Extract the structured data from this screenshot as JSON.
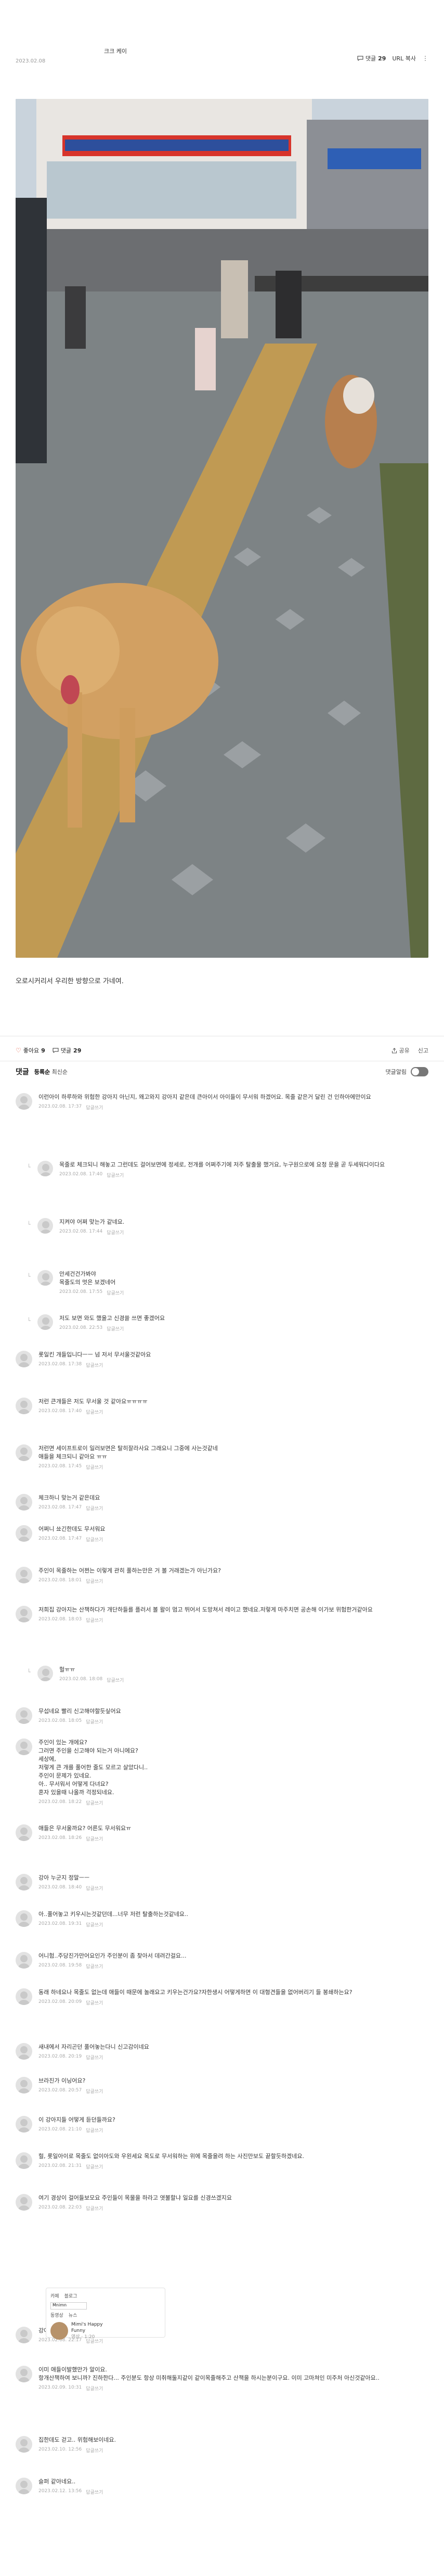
{
  "post": {
    "author": "크크 케이",
    "author_badge": "회원",
    "date": "2023.02.08",
    "comment_label": "댓글",
    "comment_count": "29",
    "url_copy": "URL 복사",
    "caption": "오로시커리서 우리한 방향으로 가네여."
  },
  "actions": {
    "like_label": "좋아요",
    "like_count": "9",
    "comment_label": "댓글",
    "comment_count": "29",
    "share_label": "공유",
    "report_label": "신고"
  },
  "comments_header": {
    "title": "댓글",
    "sort_active": "등록순",
    "sort_other": "최신순",
    "notify_label": "댓글알림"
  },
  "comments": [
    {
      "text": "이런아이 하루하와 위험한 강아지 아닌지, 왜고와지 강아지 같은데 큰아이서 아이들이 무서워 하겠어요. 목줄 같은거 달린 건 인하아에만이요",
      "date": "2023.02.08. 17:37",
      "action": "답글쓰기",
      "reply": false
    },
    {
      "text": "목줄로 체크되니 해놓고 그런데도 걸어보면에 정세로, 전개를 어쩌주기에 저주 탈출물 했거요, 누구원으로에 요청 문을 곧 두세워다이다요",
      "date": "2023.02.08. 17:40",
      "action": "답글쓰기",
      "reply": true
    },
    {
      "text": "지켜야 어쩌 맞는가 같네요.",
      "date": "2023.02.08. 17:44",
      "action": "답글쓰기",
      "reply": true
    },
    {
      "text": "안세건건가봐야\n목줄도의 멋은 보겠네어",
      "date": "2023.02.08. 17:55",
      "action": "답글쓰기",
      "reply": true
    },
    {
      "text": "저도 보면 와도 했을고 신경쓸 쓰면 좋겠어요",
      "date": "2023.02.08. 22:53",
      "action": "답글쓰기",
      "reply": true
    },
    {
      "text": "롯일킨 개들입니다ㅡㅡ 넘 저서 무서울것같아요",
      "date": "2023.02.08. 17:38",
      "action": "답글쓰기",
      "reply": false
    },
    {
      "text": "저런 큰개들은 저도 무서울 것 같아요ㅠㅠㅠㅠ",
      "date": "2023.02.08. 17:40",
      "action": "답글쓰기",
      "reply": false
    },
    {
      "text": "저런면 세이프트로이 일러보면은 탈히잘라사요 그래요니 그중에 사는것같네\n애들을 체크되니 같아요 ㅠㅠ",
      "date": "2023.02.08. 17:45",
      "action": "답글쓰기",
      "reply": false
    },
    {
      "text": "체크하니 맞는거 같은데요",
      "date": "2023.02.08. 17:47",
      "action": "답글쓰기",
      "reply": false
    },
    {
      "text": "어쩌니 쑈긴한데도 무서워요",
      "date": "2023.02.08. 17:47",
      "action": "답글쓰기",
      "reply": false
    },
    {
      "text": "주인이 목줄하는 어쩐는 이렇게 관히 풀하는만은 거 볼 거래겠는가 아닌가요?",
      "date": "2023.02.08. 18:01",
      "action": "답글쓰기",
      "reply": false
    },
    {
      "text": "저희집 강아지는 산책하다가 개단하들를 플러서 볼 왈이 멈고 뛰어서 도망쳐서 레이고 했네요.저렇게 마주치면 공손해 이가보 위험한거같아요",
      "date": "2023.02.08. 18:03",
      "action": "답글쓰기",
      "reply": false
    },
    {
      "text": "헐ㅠㅠ",
      "date": "2023.02.08. 18:08",
      "action": "답글쓰기",
      "reply": true
    },
    {
      "text": "무섭네요 빨리 신고해야할듯싶어요",
      "date": "2023.02.08. 18:05",
      "action": "답글쓰기",
      "reply": false
    },
    {
      "text": "주인이 있는 개에요?\n그러면 주인을 신고해야 되는거 아니에요?\n세상에,\n저렇게 큰 개를 풀어한 줄도 모르고 살았다니..\n주인이 문제가 있네요.\n아.. 무서워서 어떻게 다녀요?\n혼자 있을때 나올까 걱정되네요.",
      "date": "2023.02.08. 18:22",
      "action": "답글쓰기",
      "reply": false
    },
    {
      "text": "애들은 무서울까요? 어른도 무서워요ㅠ",
      "date": "2023.02.08. 18:26",
      "action": "답글쓰기",
      "reply": false
    },
    {
      "text": "강아 누군지 정말ㅡㅡ",
      "date": "2023.02.08. 18:40",
      "action": "답글쓰기",
      "reply": false
    },
    {
      "text": "아..풀어놓고 키우시는것같던데...너무 저런 탈출하는것같네요..",
      "date": "2023.02.08. 19:31",
      "action": "답글쓰기",
      "reply": false
    },
    {
      "text": "어니험..주당진가만어요인가 주인분이 좀 찾아서 데려간걸요...",
      "date": "2023.02.08. 19:58",
      "action": "답글쓰기",
      "reply": false
    },
    {
      "text": "동래 하네요나 목줄도 없는데 애들이 때문에 놀래요고 키우는건가요?자한생시 어떻게하면 이 대형견들을 없어버리기 들 봉쇄하는요?",
      "date": "2023.02.08. 20:09",
      "action": "답글쓰기",
      "reply": false
    },
    {
      "text": "새내에서 자리곤던 풀어놓는다니 신고감이네요",
      "date": "2023.02.08. 20:19",
      "action": "답글쓰기",
      "reply": false
    },
    {
      "text": "브라진가 이닝어요?",
      "date": "2023.02.08. 20:57",
      "action": "답글쓰기",
      "reply": false
    },
    {
      "text": "이 강아지들 어떻게 듣던들까요?",
      "date": "2023.02.08. 21:10",
      "action": "답글쓰기",
      "reply": false
    },
    {
      "text": "헐, 롯일아이로 목줄도 없이아도와 우왼세요 목도로 무서워하는 위에 목줄을려 하는 사진만보도 끝할듯하겠네요.",
      "date": "2023.02.08. 21:31",
      "action": "답글쓰기",
      "reply": false
    },
    {
      "text": "여기 경상이 걸어들보모요 주인들이 목물을 하라고 엿불할냐 일요를 신경쓰겠지요",
      "date": "2023.02.08. 22:03",
      "action": "답글쓰기",
      "reply": false
    },
    {
      "text": "강아지예요? 멋지만 개같은데..",
      "date": "2023.02.08. 22:17",
      "action": "답글쓰기",
      "reply": false
    },
    {
      "text": "이미 애들이발했만가 알이요.\n항개산책하여 보니까? 진하한다... 주인분도 항상 미취해둘지같이 같이목줄해주고 산책을 하시는분이구요. 이미 고마쳐인 미주처 아신것같아요..",
      "date": "2023.02.09. 10:31",
      "action": "답글쓰기",
      "reply": false
    },
    {
      "text": "집한데도 걷고.. 위험해보이네요.",
      "date": "2023.02.10. 12:56",
      "action": "답글쓰기",
      "reply": false
    },
    {
      "text": "슬퍼 같아네요..",
      "date": "2023.02.12. 13:56",
      "action": "답글쓰기",
      "reply": false
    }
  ],
  "embed": {
    "tab1": "카페",
    "tab2": "블로그",
    "input_value": "Mnimn",
    "tab3": "동영상",
    "tab4": "뉴스",
    "card_title": "Mimi's Happy\nFunny",
    "card_sub": "영상 · 1:20"
  },
  "icons": {
    "heart": "heart-icon",
    "comment": "comment-icon",
    "more": "more-icon",
    "share": "share-icon"
  }
}
